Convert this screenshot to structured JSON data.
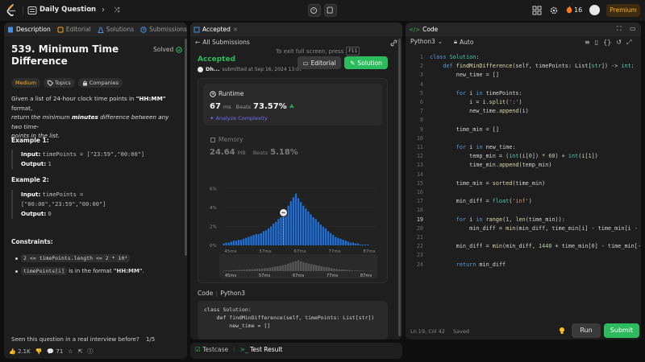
{
  "topbar": {
    "title": "Daily Question",
    "streak": "16",
    "premium": "Premium",
    "colors": {
      "accent": "#ffa116",
      "premium_text": "#ffb300"
    }
  },
  "left": {
    "tabs": [
      {
        "label": "Description",
        "icon": "document-icon",
        "active": true
      },
      {
        "label": "Editorial",
        "icon": "book-icon"
      },
      {
        "label": "Solutions",
        "icon": "flask-icon"
      },
      {
        "label": "Submissions",
        "icon": "history-icon"
      }
    ],
    "title": "539. Minimum Time Difference",
    "solved": "Solved",
    "chips": {
      "difficulty": "Medium",
      "topics": "Topics",
      "companies": "Companies"
    },
    "desc_line1_pre": "Given a list of 24-hour clock time points in ",
    "desc_format": "\"HH:MM\"",
    "desc_line1_post": " format,",
    "desc_line2_pre": "return the minimum ",
    "desc_minutes": "minutes",
    "desc_line2_post": " difference between any two time-",
    "desc_line3": "points in the list.",
    "ex1": {
      "heading": "Example 1:",
      "input_label": "Input:",
      "input": "timePoints = [\"23:59\",\"00:00\"]",
      "output_label": "Output:",
      "output": "1"
    },
    "ex2": {
      "heading": "Example 2:",
      "input_label": "Input:",
      "input_a": "timePoints =",
      "input_b": "[\"00:00\",\"23:59\",\"00:00\"]",
      "output_label": "Output:",
      "output": "0"
    },
    "constraints_heading": "Constraints:",
    "constraint1": "2 <= timePoints.length <= 2 * 10⁴",
    "constraint2_code": "timePoints[i]",
    "constraint2_text": " is in the format ",
    "constraint2_fmt": "\"HH:MM\"",
    "constraint2_end": ".",
    "seen_q": "Seen this question in a real interview before?",
    "seen_page": "1/5",
    "likes": "2.1K",
    "comments": "71"
  },
  "mid": {
    "tab_label": "Accepted",
    "all_submissions": "All Submissions",
    "exit_hint": "To exit full screen, press",
    "exit_key": "F11",
    "status": "Accepted",
    "submitter": "Dh...",
    "submitted_at": "submitted at Sep 16, 2024 13:07",
    "editorial_btn": "Editorial",
    "solution_btn": "Solution",
    "runtime_label": "Runtime",
    "runtime_value": "67",
    "runtime_unit": "ms",
    "beats_label": "Beats",
    "runtime_beats": "73.57%",
    "analyze": "Analyze Complexity",
    "memory_label": "Memory",
    "memory_value": "24.64",
    "memory_unit": "MB",
    "memory_beats_label": "Beats",
    "memory_beats": "5.18%",
    "code_label": "Code",
    "code_lang": "Python3",
    "code_snippet": "class Solution:\n    def findMinDifference(self, timePoints: List[str])\n        new_time = []",
    "bottom_tabs": [
      "Testcase",
      "Test Result"
    ]
  },
  "chart_data": {
    "type": "bar",
    "yticks": [
      "6%",
      "4%",
      "2%",
      "0%"
    ],
    "ylim": [
      0,
      7
    ],
    "xticks": [
      "45ms",
      "57ms",
      "67ms",
      "77ms",
      "87ms"
    ],
    "minimap_xticks": [
      "45ms",
      "57ms",
      "67ms",
      "77ms",
      "87ms"
    ],
    "values": [
      0.2,
      0.3,
      0.3,
      0.4,
      0.5,
      0.5,
      0.6,
      0.6,
      0.7,
      0.8,
      0.9,
      1.0,
      1.1,
      1.2,
      1.2,
      1.3,
      1.5,
      1.6,
      1.8,
      2.0,
      2.3,
      2.5,
      2.8,
      3.0,
      3.3,
      3.8,
      4.2,
      4.7,
      5.1,
      5.5,
      5.0,
      4.6,
      4.2,
      3.9,
      3.6,
      3.3,
      3.0,
      2.8,
      2.5,
      2.2,
      2.0,
      1.8,
      1.5,
      1.3,
      1.1,
      0.9,
      0.8,
      0.7,
      0.6,
      0.5,
      0.4,
      0.3,
      0.3,
      0.2,
      0.2,
      0.1,
      0.1,
      0.1,
      0.1
    ],
    "highlight_index": 24,
    "colors": {
      "bar": "#1e6fd9",
      "bar_light": "#3a8ef0",
      "grid": "#333333"
    }
  },
  "editor": {
    "tab_label": "Code",
    "lang": "Python3",
    "auto": "Auto",
    "status": "Ln 19, Col 42",
    "saved": "Saved",
    "run": "Run",
    "submit": "Submit",
    "current_line": 19,
    "lines": [
      {
        "n": 1,
        "h": "<span class='kw'>class</span> <span class='ty'>Solution</span>:"
      },
      {
        "n": 2,
        "h": "    <span class='kw'>def</span> <span class='fn'>findMinDifference</span>(self, timePoints: List[<span class='ty'>str</span>]) -> <span class='ty'>int</span>:"
      },
      {
        "n": 3,
        "h": "        new_time = []"
      },
      {
        "n": 4,
        "h": ""
      },
      {
        "n": 5,
        "h": "        <span class='kw'>for</span> i <span class='kw'>in</span> timePoints:"
      },
      {
        "n": 6,
        "h": "            i = i.<span class='fn'>split</span>(<span class='st'>':'</span>)"
      },
      {
        "n": 7,
        "h": "            new_time.<span class='fn'>append</span>(i)"
      },
      {
        "n": 8,
        "h": ""
      },
      {
        "n": 9,
        "h": "        time_min = []"
      },
      {
        "n": 10,
        "h": ""
      },
      {
        "n": 11,
        "h": "        <span class='kw'>for</span> i <span class='kw'>in</span> new_time:"
      },
      {
        "n": 12,
        "h": "            temp_min = (<span class='ty'>int</span>(i[<span class='nm'>0</span>]) * <span class='nm'>60</span>) + <span class='ty'>int</span>(i[<span class='nm'>1</span>])"
      },
      {
        "n": 13,
        "h": "            time_min.<span class='fn'>append</span>(temp_min)"
      },
      {
        "n": 14,
        "h": ""
      },
      {
        "n": 15,
        "h": "        time_min = <span class='fn'>sorted</span>(time_min)"
      },
      {
        "n": 16,
        "h": ""
      },
      {
        "n": 17,
        "h": "        min_diff = <span class='ty'>float</span>(<span class='st'>'inf'</span>)"
      },
      {
        "n": 18,
        "h": ""
      },
      {
        "n": 19,
        "h": "        <span class='kw'>for</span> i <span class='kw'>in</span> <span class='fn'>range</span>(<span class='nm'>1</span>, <span class='fn'>len</span>(time_min)):"
      },
      {
        "n": 20,
        "h": "            min_diff = <span class='fn'>min</span>(min_diff, time_min[i] - time_min[i - <span class='nm'>1</span>])"
      },
      {
        "n": 21,
        "h": ""
      },
      {
        "n": 22,
        "h": "        min_diff = <span class='fn'>min</span>(min_diff, <span class='nm'>1440</span> + time_min[<span class='nm'>0</span>] - time_min[<span class='nm'>-1</span>])"
      },
      {
        "n": 23,
        "h": ""
      },
      {
        "n": 24,
        "h": "        <span class='kw'>return</span> min_diff"
      }
    ]
  }
}
